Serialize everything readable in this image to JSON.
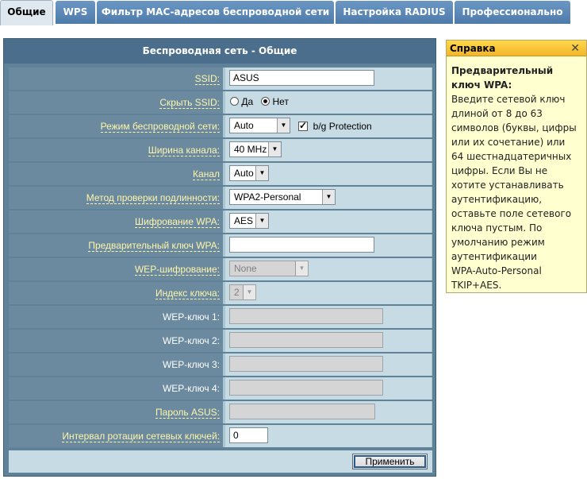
{
  "tabs": [
    {
      "label": "Общие",
      "active": true
    },
    {
      "label": "WPS",
      "active": false
    },
    {
      "label": "Фильтр MAC-адресов беспроводной сети",
      "active": false
    },
    {
      "label": "Настройка RADIUS",
      "active": false
    },
    {
      "label": "Профессионально",
      "active": false
    }
  ],
  "panel": {
    "title": "Беспроводная сеть - Общие"
  },
  "form": {
    "ssid": {
      "label": "SSID:",
      "value": "ASUS"
    },
    "hide_ssid": {
      "label": "Скрыть SSID:",
      "opt_yes": "Да",
      "opt_no": "Нет",
      "selected": "Нет"
    },
    "wireless_mode": {
      "label": "Режим беспроводной сети:",
      "value": "Auto",
      "checkbox_label": "b/g Protection",
      "checkbox_checked": true
    },
    "channel_width": {
      "label": "Ширина канала:",
      "value": "40 MHz"
    },
    "channel": {
      "label": "Канал",
      "value": "Auto"
    },
    "auth_method": {
      "label": "Метод проверки подлинности:",
      "value": "WPA2-Personal"
    },
    "wpa_encryption": {
      "label": "Шифрование WPA:",
      "value": "AES"
    },
    "wpa_key": {
      "label": "Предварительный ключ WPA:",
      "value": ""
    },
    "wep_encryption": {
      "label": "WEP-шифрование:",
      "value": "None"
    },
    "key_index": {
      "label": "Индекс ключа:",
      "value": "2"
    },
    "wep_key1": {
      "label": "WEP-ключ 1:",
      "value": ""
    },
    "wep_key2": {
      "label": "WEP-ключ 2:",
      "value": ""
    },
    "wep_key3": {
      "label": "WEP-ключ 3:",
      "value": ""
    },
    "wep_key4": {
      "label": "WEP-ключ 4:",
      "value": ""
    },
    "asus_password": {
      "label": "Пароль ASUS:",
      "value": ""
    },
    "key_rotation": {
      "label": "Интервал ротации сетевых ключей:",
      "value": "0"
    }
  },
  "apply_label": "Применить",
  "help": {
    "header": "Справка",
    "close_glyph": "✕",
    "title_line1": "Предварительный",
    "title_line2": "ключ WPA:",
    "lines": [
      "Введите сетевой ключ",
      "длиной от 8 до 63",
      "символов (буквы, цифры",
      "или их сочетание) или",
      "64 шестнадцатеричных",
      "цифры. Если Вы не",
      "хотите устанавливать",
      "аутентификацию,",
      "оставьте поле сетевого",
      "ключа пустым. По",
      "умолчанию режим",
      "аутентификации",
      "WPA-Auto-Personal",
      "TKIP+AES."
    ]
  },
  "colors": {
    "tab_bg": "#5a86b6",
    "panel_bg": "#5f8298",
    "row_bg": "#c7dbe4",
    "label_link": "#fff6a8",
    "help_bg": "#ffffcf",
    "help_header": "#f3b52a"
  }
}
